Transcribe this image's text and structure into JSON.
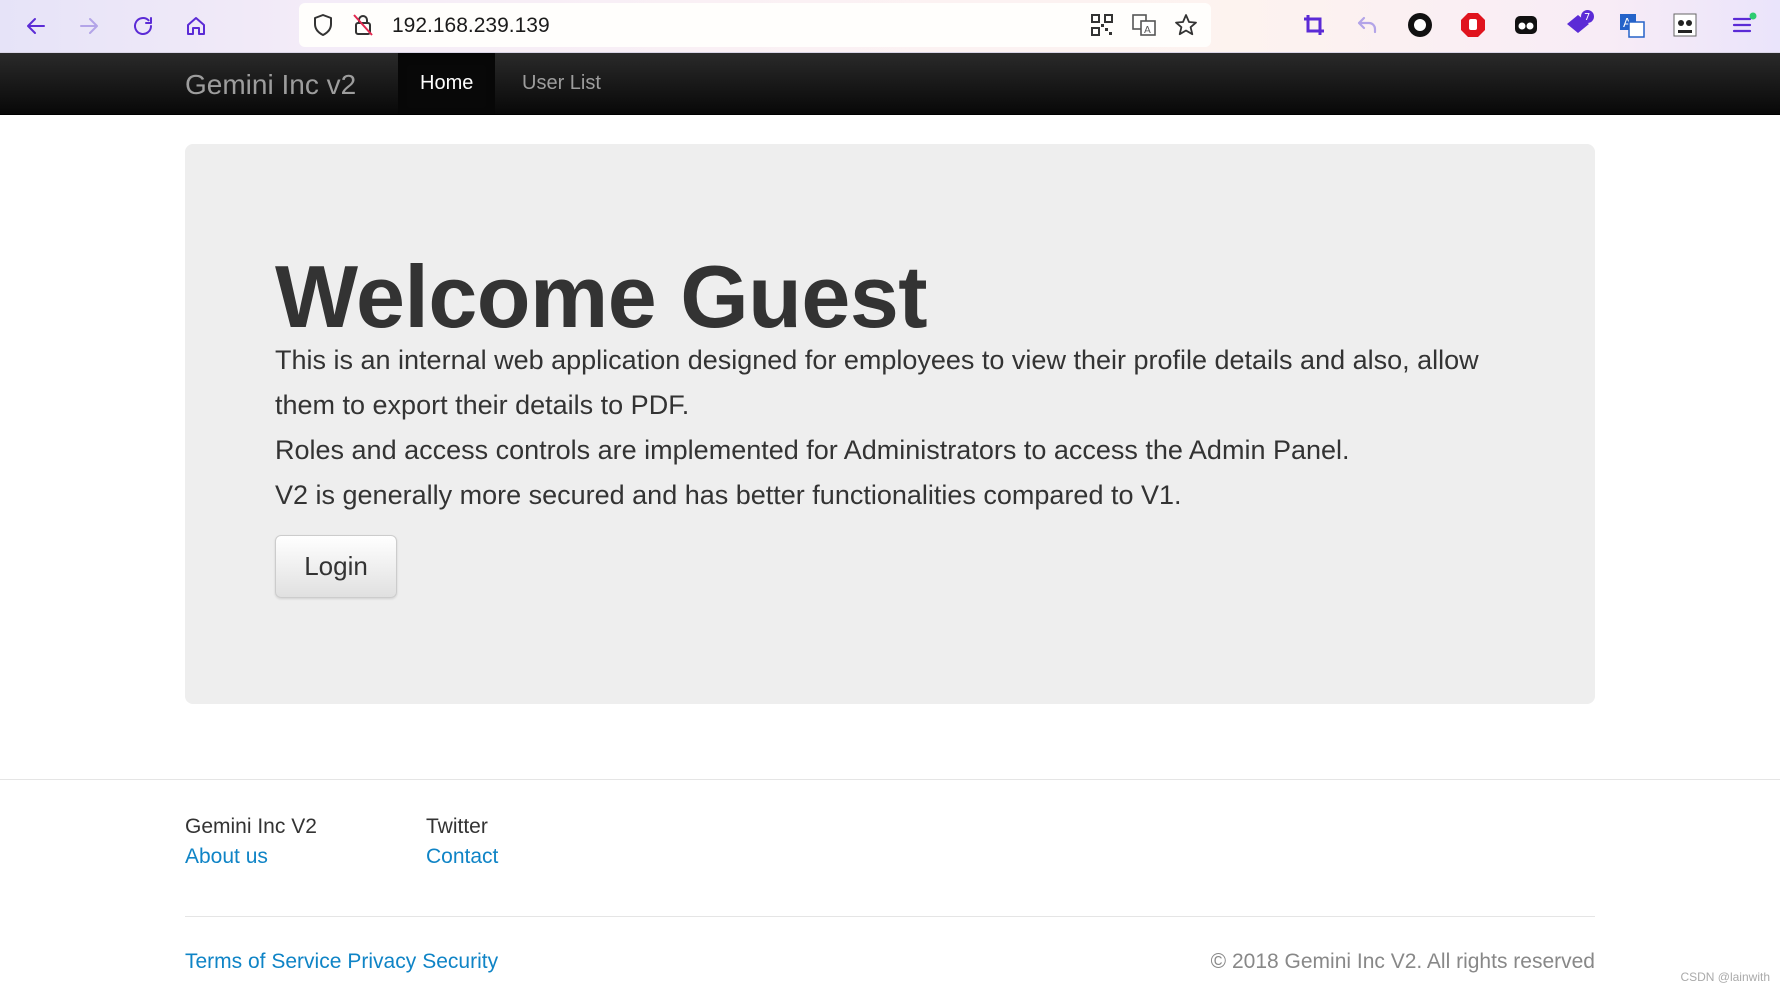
{
  "browser": {
    "url": "192.168.239.139",
    "extension_badge": "7",
    "icons": [
      "back-arrow-icon",
      "forward-arrow-icon",
      "reload-icon",
      "home-icon",
      "shield-icon",
      "insecure-lock-icon",
      "qr-code-icon",
      "translate-icon",
      "bookmark-star-icon",
      "crop-icon",
      "undo-icon",
      "record-icon",
      "adblock-icon",
      "extension-icon",
      "gift-extension-icon",
      "translate-extension-icon",
      "panda-icon",
      "menu-icon"
    ]
  },
  "navbar": {
    "brand": "Gemini Inc v2",
    "items": [
      {
        "label": "Home",
        "active": true
      },
      {
        "label": "User List",
        "active": false
      }
    ]
  },
  "jumbotron": {
    "heading": "Welcome Guest",
    "paragraphs": [
      "This is an internal web application designed for employees to view their profile details and also, allow them to export their details to PDF.",
      "Roles and access controls are implemented for Administrators to access the Admin Panel.",
      "V2 is generally more secured and has better functionalities compared to V1."
    ],
    "login_label": "Login"
  },
  "footer": {
    "columns": [
      {
        "heading": "Gemini Inc V2",
        "link": "About us"
      },
      {
        "heading": "Twitter",
        "link": "Contact"
      }
    ],
    "bottom_links": [
      "Terms of Service",
      "Privacy",
      "Security"
    ],
    "copyright": "© 2018 Gemini Inc V2. All rights reserved",
    "watermark": "CSDN @lainwith"
  },
  "colors": {
    "link": "#0f84c6",
    "navbar_bg": "#080808",
    "jumbotron_bg": "#eeeeee",
    "browser_accent": "#5b2bd6"
  }
}
